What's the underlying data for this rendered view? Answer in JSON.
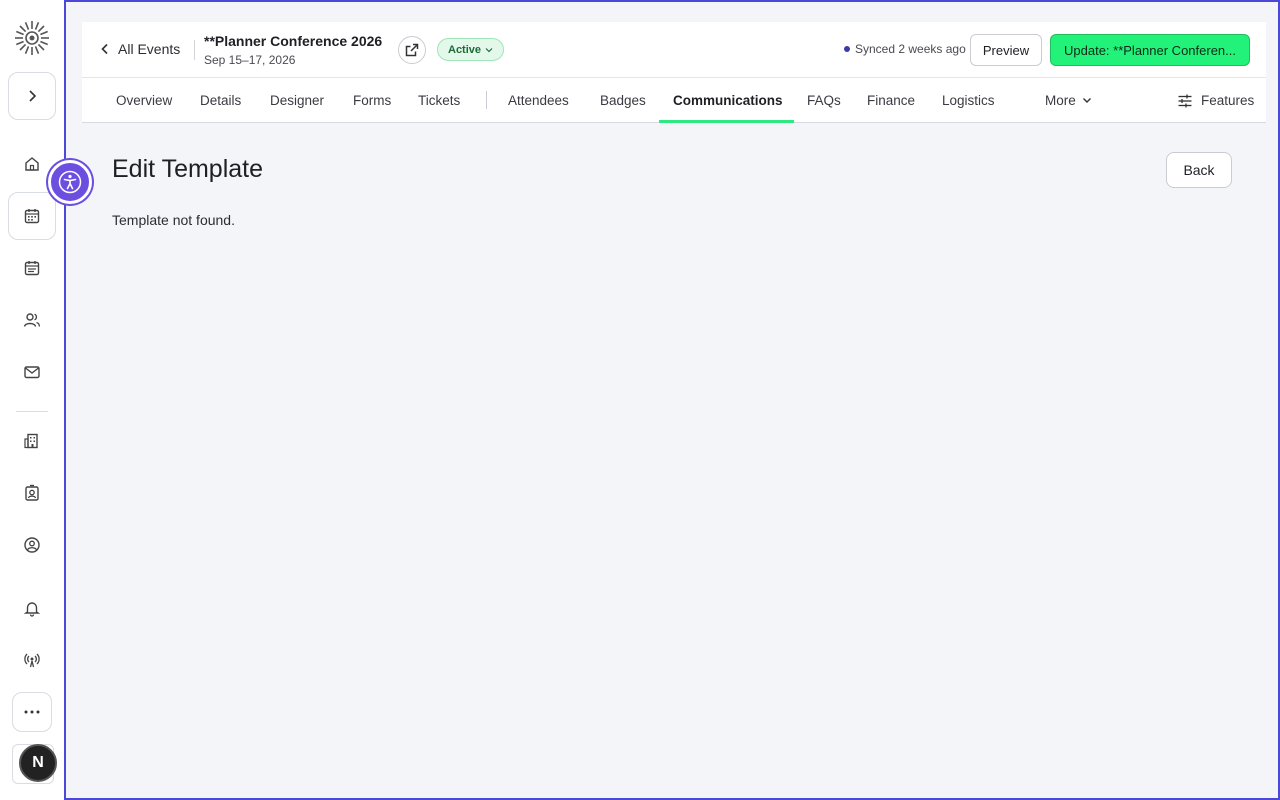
{
  "header": {
    "back_label": "All Events",
    "event_title": "**Planner Conference 2026",
    "event_date": "Sep 15–17, 2026",
    "status": "Active",
    "sync_text": "Synced 2 weeks ago",
    "preview_label": "Preview",
    "update_label": "Update: **Planner Conferen..."
  },
  "tabs": [
    {
      "label": "Overview"
    },
    {
      "label": "Details"
    },
    {
      "label": "Designer"
    },
    {
      "label": "Forms"
    },
    {
      "label": "Tickets"
    },
    {
      "label": "Attendees"
    },
    {
      "label": "Badges"
    },
    {
      "label": "Communications",
      "active": true
    },
    {
      "label": "FAQs"
    },
    {
      "label": "Finance"
    },
    {
      "label": "Logistics"
    }
  ],
  "more_label": "More",
  "features_label": "Features",
  "main": {
    "title": "Edit Template",
    "back_label": "Back",
    "message": "Template not found."
  },
  "rail": {
    "icons": [
      "home-icon",
      "calendar-icon",
      "schedule-icon",
      "users-icon",
      "mail-icon",
      "building-icon",
      "badge-icon",
      "user-circle-icon",
      "bell-icon",
      "broadcast-icon"
    ],
    "avatar_letter": "N"
  },
  "colors": {
    "accent": "#22f27a",
    "frame_border": "#4b49d6",
    "accessibility": "#6c4fe0"
  }
}
